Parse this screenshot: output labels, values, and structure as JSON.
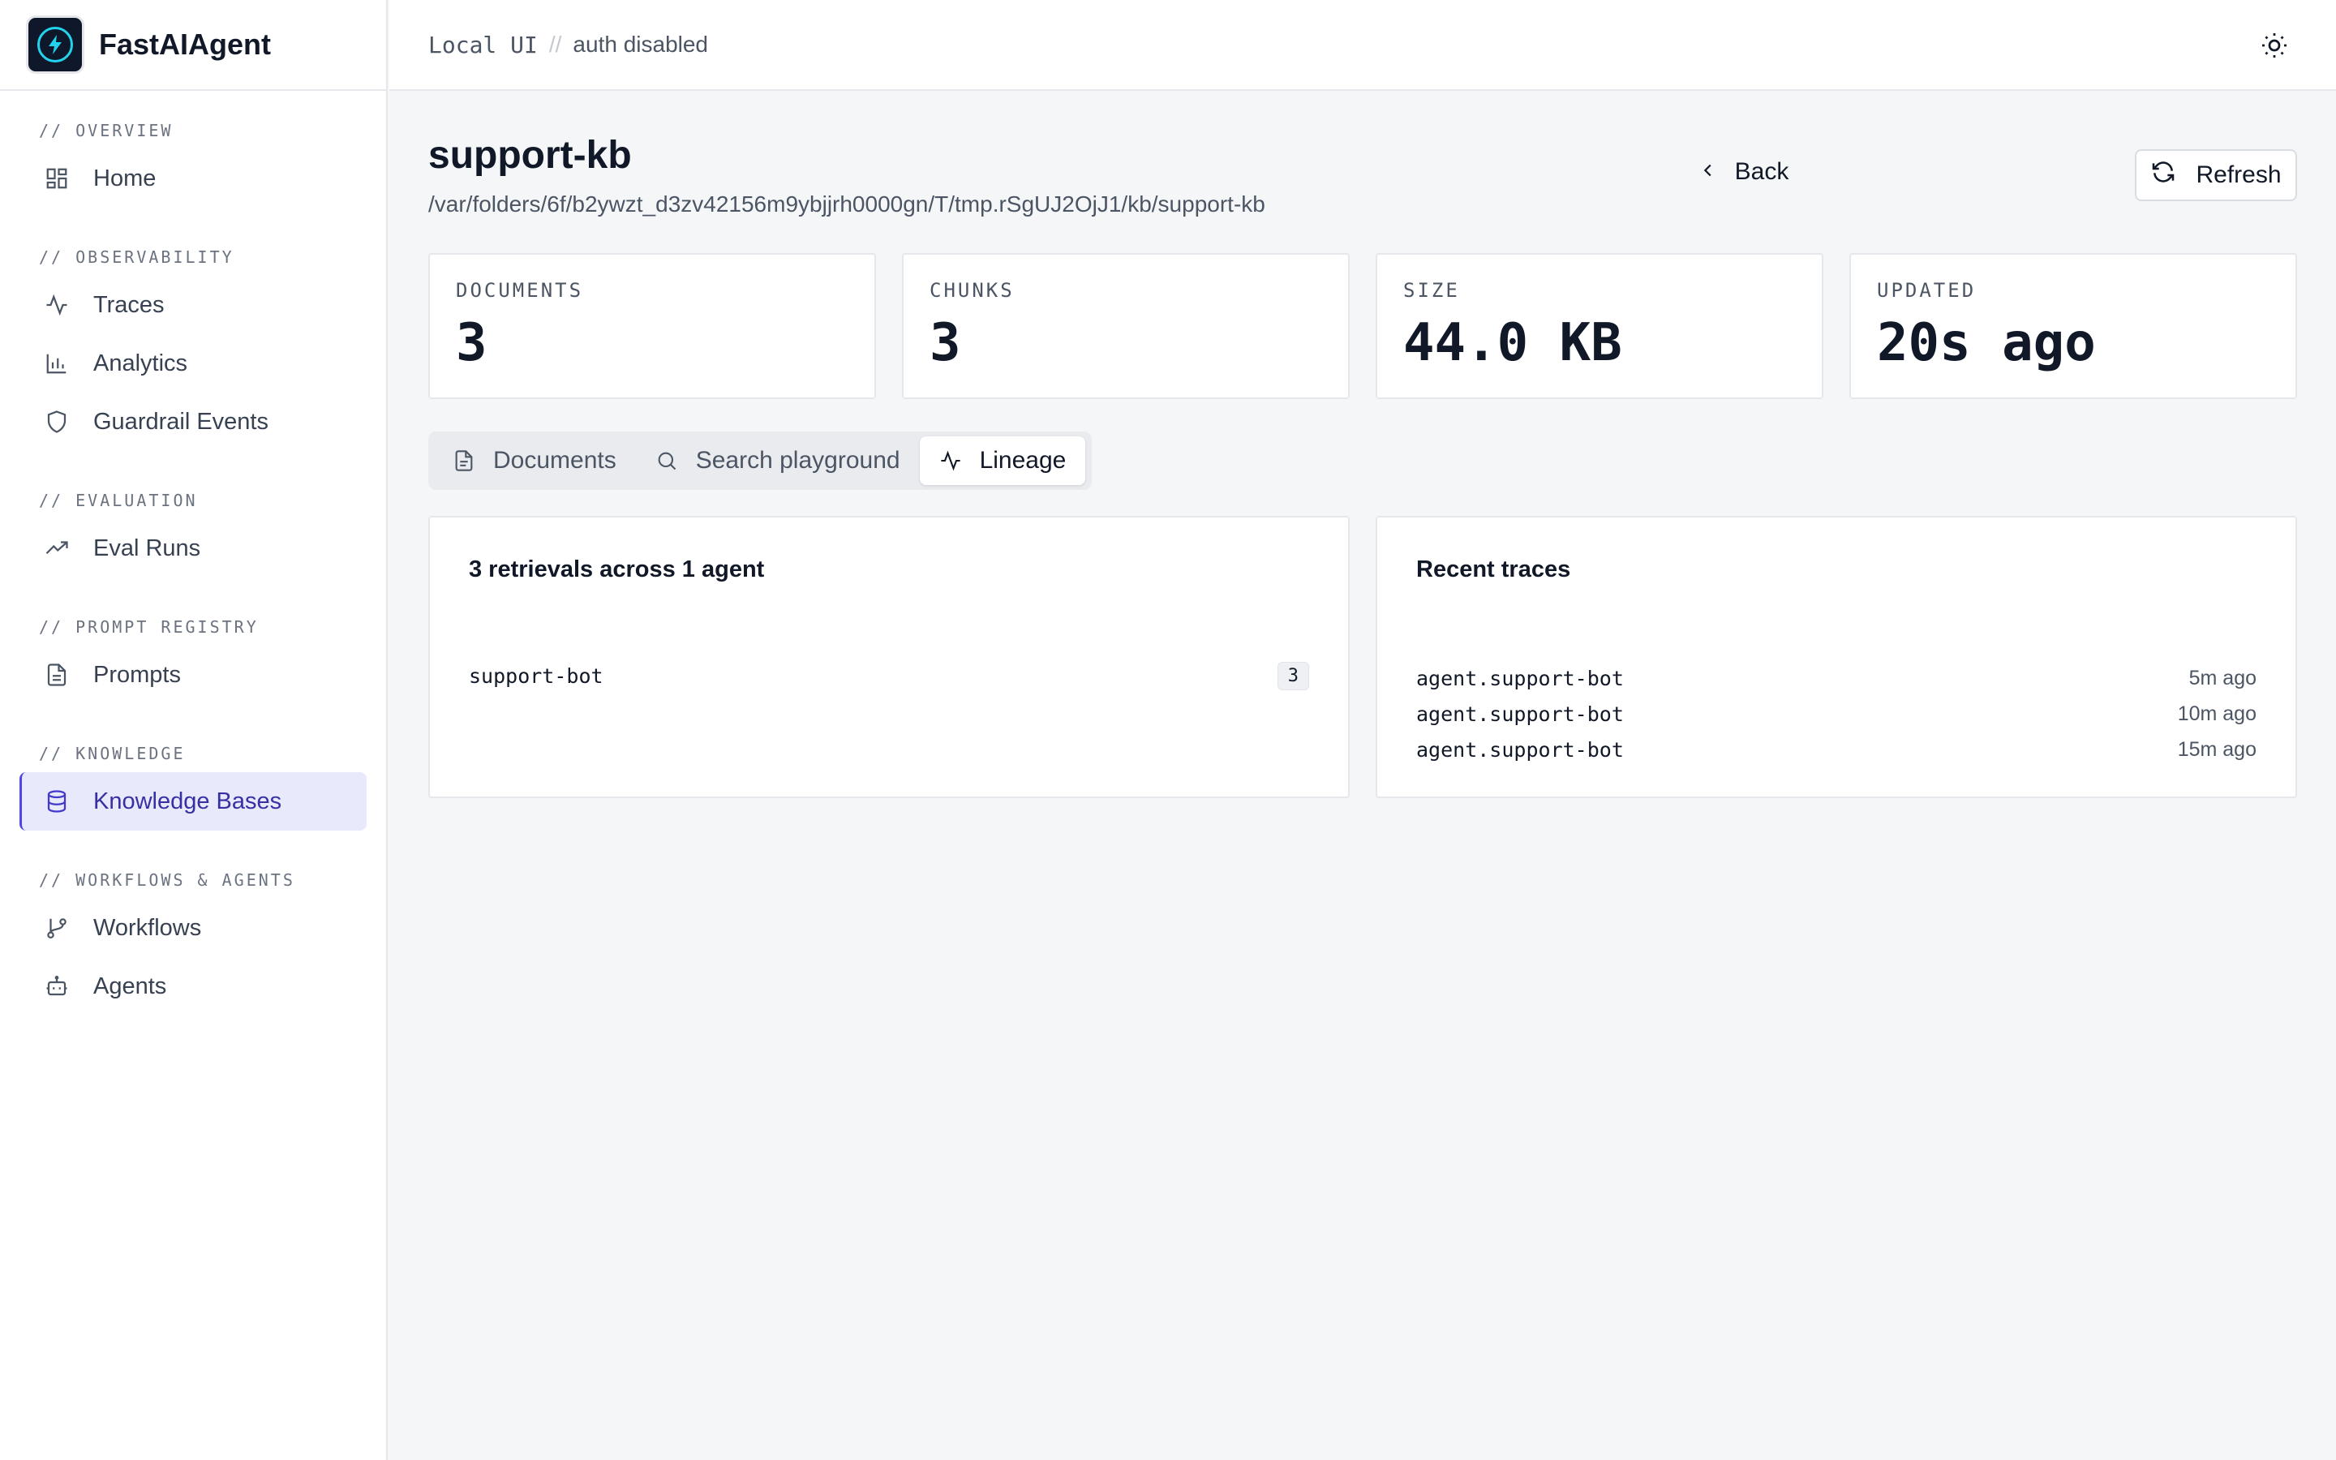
{
  "brand": {
    "name": "FastAIAgent"
  },
  "topbar": {
    "local_label": "Local UI",
    "separator": "//",
    "auth_label": "auth disabled"
  },
  "sidebar": {
    "sections": [
      {
        "label": "// OVERVIEW",
        "items": [
          {
            "label": "Home",
            "icon": "grid-icon"
          }
        ]
      },
      {
        "label": "// OBSERVABILITY",
        "items": [
          {
            "label": "Traces",
            "icon": "activity-icon"
          },
          {
            "label": "Analytics",
            "icon": "bar-chart-icon"
          },
          {
            "label": "Guardrail Events",
            "icon": "shield-icon"
          }
        ]
      },
      {
        "label": "// EVALUATION",
        "items": [
          {
            "label": "Eval Runs",
            "icon": "trending-up-icon"
          }
        ]
      },
      {
        "label": "// PROMPT REGISTRY",
        "items": [
          {
            "label": "Prompts",
            "icon": "file-text-icon"
          }
        ]
      },
      {
        "label": "// KNOWLEDGE",
        "items": [
          {
            "label": "Knowledge Bases",
            "icon": "database-icon",
            "active": true
          }
        ]
      },
      {
        "label": "// WORKFLOWS & AGENTS",
        "items": [
          {
            "label": "Workflows",
            "icon": "git-branch-icon"
          },
          {
            "label": "Agents",
            "icon": "bot-icon"
          }
        ]
      }
    ]
  },
  "page": {
    "title": "support-kb",
    "path": "/var/folders/6f/b2ywzt_d3zv42156m9ybjjrh0000gn/T/tmp.rSgUJ2OjJ1/kb/support-kb",
    "back_label": "Back",
    "refresh_label": "Refresh"
  },
  "stats": [
    {
      "label": "DOCUMENTS",
      "value": "3"
    },
    {
      "label": "CHUNKS",
      "value": "3"
    },
    {
      "label": "SIZE",
      "value": "44.0 KB"
    },
    {
      "label": "UPDATED",
      "value": "20s ago"
    }
  ],
  "tabs": [
    {
      "label": "Documents",
      "icon": "file-icon"
    },
    {
      "label": "Search playground",
      "icon": "search-icon"
    },
    {
      "label": "Lineage",
      "icon": "activity-icon",
      "active": true
    }
  ],
  "lineage": {
    "title": "3 retrievals across 1 agent",
    "agents": [
      {
        "name": "support-bot",
        "count": "3"
      }
    ]
  },
  "recent_traces": {
    "title": "Recent traces",
    "rows": [
      {
        "name": "agent.support-bot",
        "time": "5m ago"
      },
      {
        "name": "agent.support-bot",
        "time": "10m ago"
      },
      {
        "name": "agent.support-bot",
        "time": "15m ago"
      }
    ]
  },
  "colors": {
    "accent": "#4f46e5",
    "active_bg": "#e8e9fb",
    "logo_bg": "#0f172a",
    "logo_ring": "#22d3ee"
  }
}
